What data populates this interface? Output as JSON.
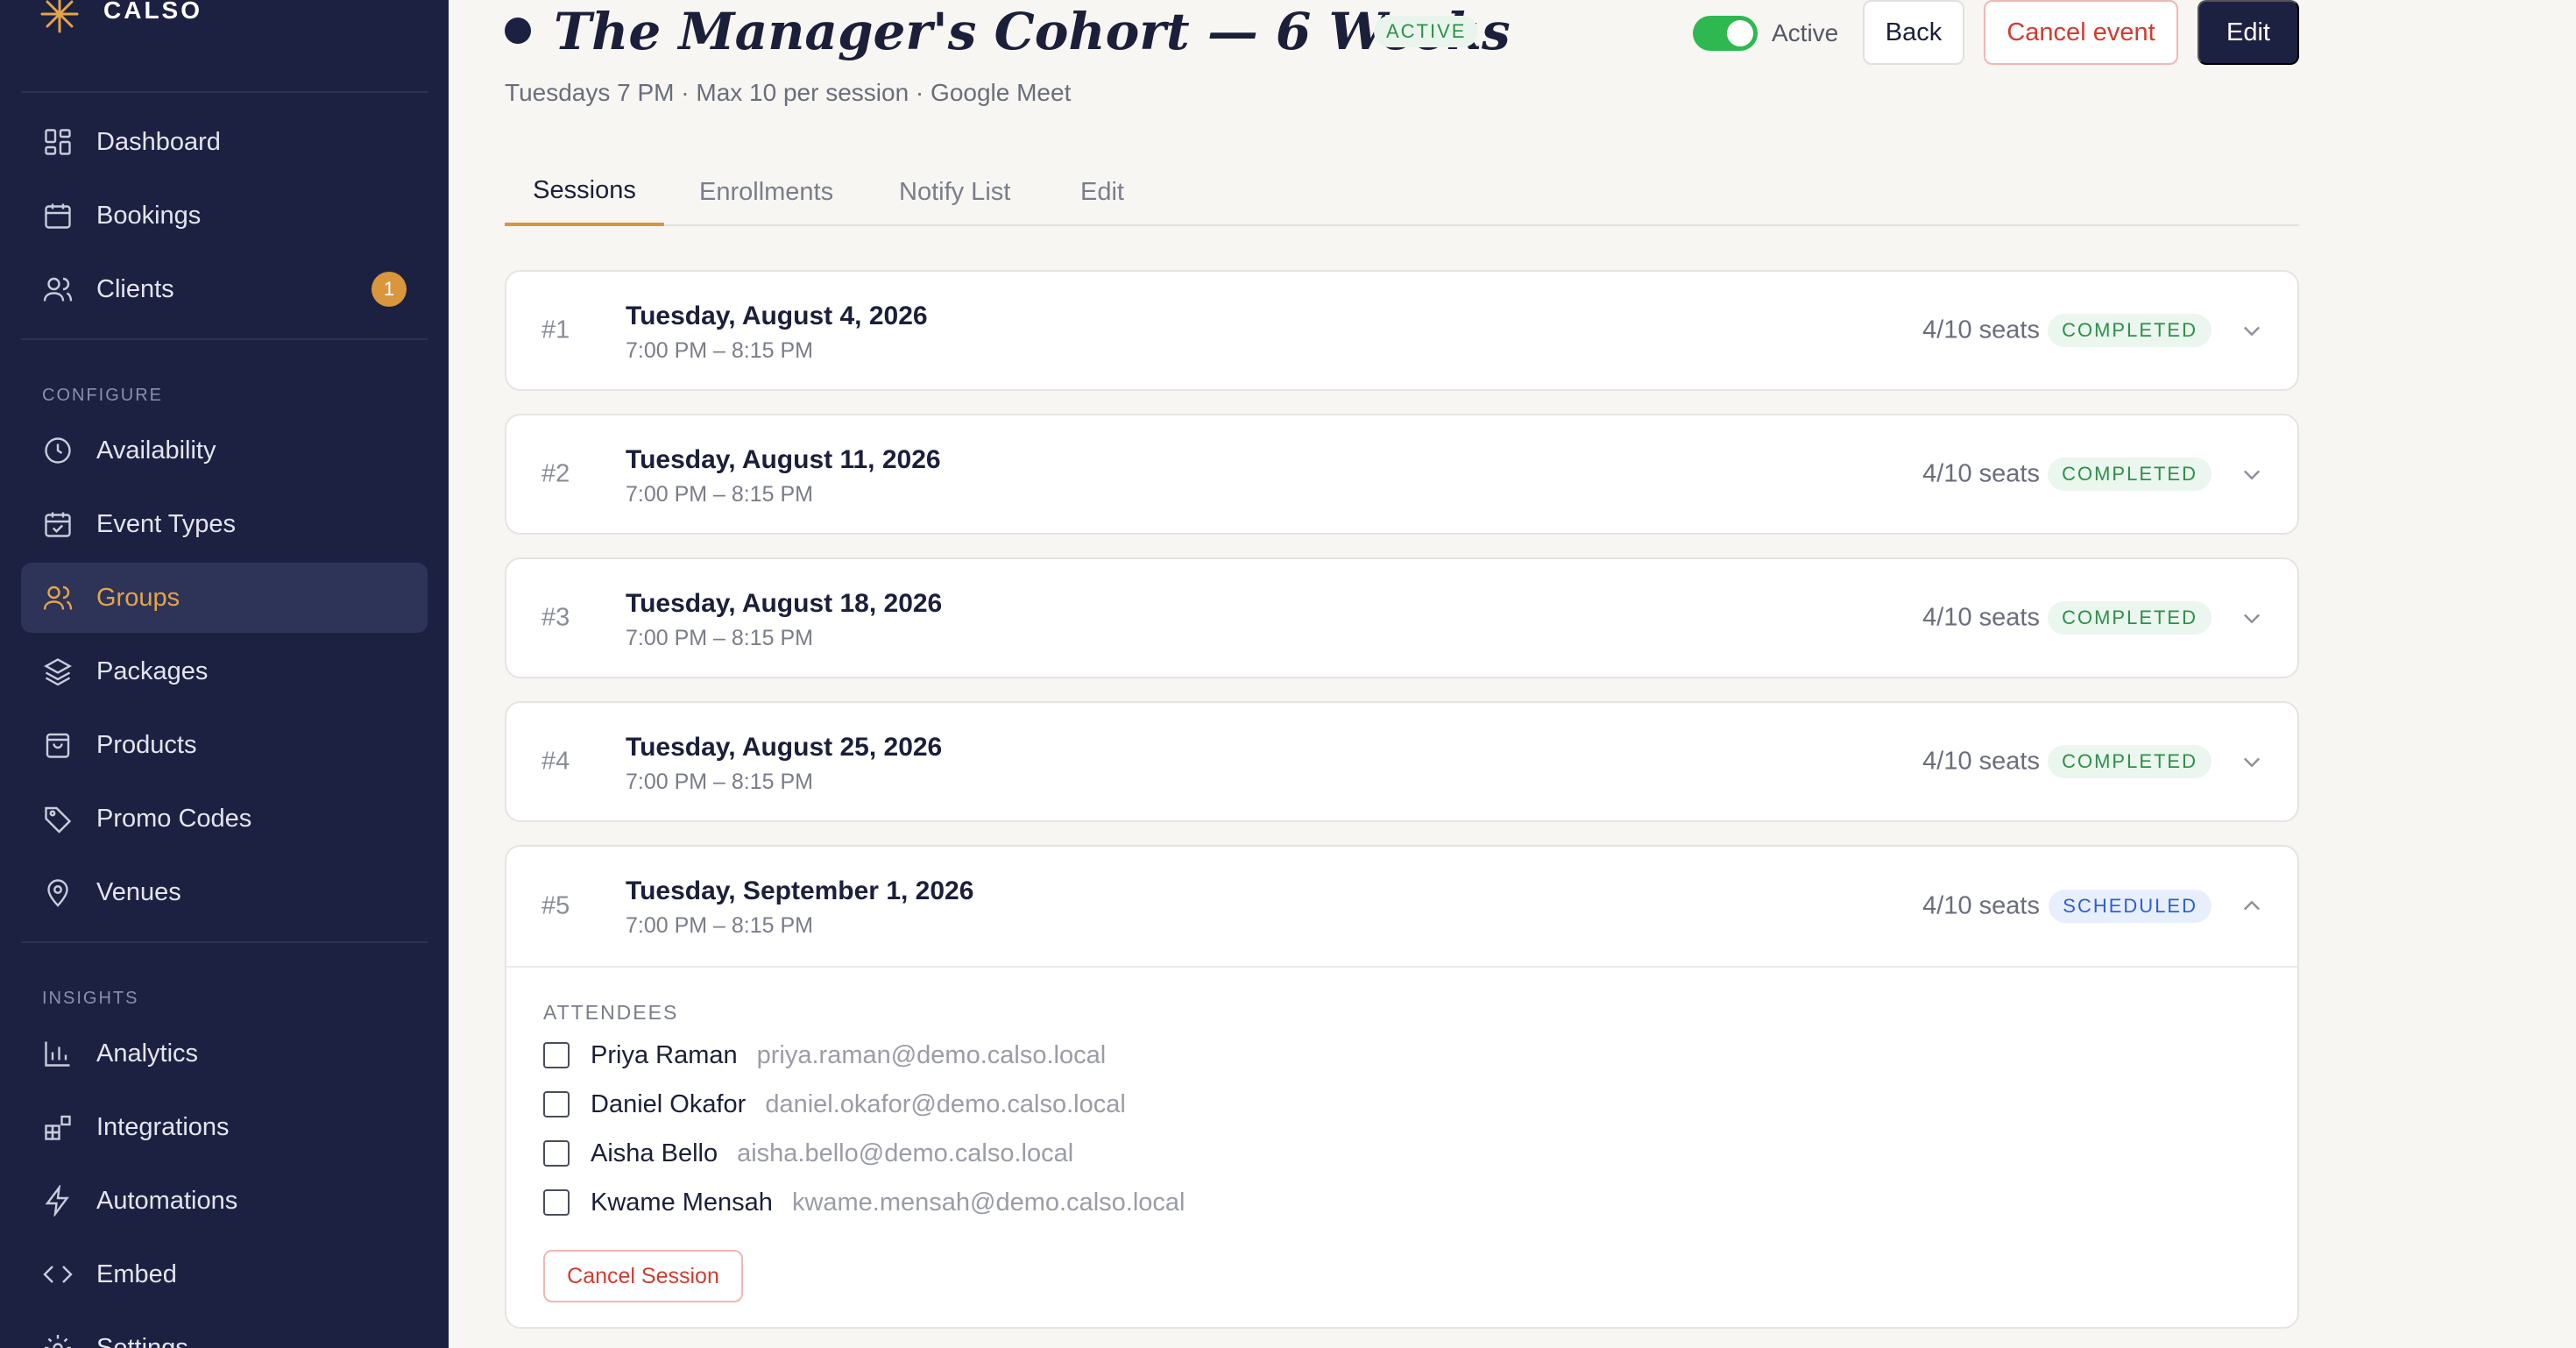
{
  "app": {
    "brand": "CALSO"
  },
  "sidebar": {
    "primary": [
      {
        "label": "Dashboard",
        "icon": "dashboard-icon"
      },
      {
        "label": "Bookings",
        "icon": "calendar-icon"
      },
      {
        "label": "Clients",
        "icon": "users-icon",
        "badge": "1"
      }
    ],
    "configure_label": "CONFIGURE",
    "configure": [
      {
        "label": "Availability",
        "icon": "clock-icon"
      },
      {
        "label": "Event Types",
        "icon": "calendar-check-icon"
      },
      {
        "label": "Groups",
        "icon": "users-icon",
        "active": true
      },
      {
        "label": "Packages",
        "icon": "layers-icon"
      },
      {
        "label": "Products",
        "icon": "shopping-bag-icon"
      },
      {
        "label": "Promo Codes",
        "icon": "tag-icon"
      },
      {
        "label": "Venues",
        "icon": "map-pin-icon"
      }
    ],
    "insights_label": "INSIGHTS",
    "insights": [
      {
        "label": "Analytics",
        "icon": "bar-chart-icon"
      },
      {
        "label": "Integrations",
        "icon": "integrations-icon"
      },
      {
        "label": "Automations",
        "icon": "lightning-icon"
      },
      {
        "label": "Embed",
        "icon": "code-icon"
      },
      {
        "label": "Settings",
        "icon": "gear-icon"
      }
    ]
  },
  "header": {
    "title": "The Manager's Cohort — 6 Weeks",
    "status": "ACTIVE",
    "subtitle": "Tuesdays 7 PM · Max 10 per session · Google Meet",
    "toggle_label": "Active",
    "back_label": "Back",
    "cancel_event_label": "Cancel event",
    "edit_label": "Edit"
  },
  "tabs": [
    {
      "label": "Sessions",
      "active": true
    },
    {
      "label": "Enrollments"
    },
    {
      "label": "Notify List"
    },
    {
      "label": "Edit"
    }
  ],
  "sessions": [
    {
      "num": "#1",
      "date": "Tuesday, August 4, 2026",
      "time": "7:00 PM – 8:15 PM",
      "seats": "4/10 seats",
      "status": "COMPLETED"
    },
    {
      "num": "#2",
      "date": "Tuesday, August 11, 2026",
      "time": "7:00 PM – 8:15 PM",
      "seats": "4/10 seats",
      "status": "COMPLETED"
    },
    {
      "num": "#3",
      "date": "Tuesday, August 18, 2026",
      "time": "7:00 PM – 8:15 PM",
      "seats": "4/10 seats",
      "status": "COMPLETED"
    },
    {
      "num": "#4",
      "date": "Tuesday, August 25, 2026",
      "time": "7:00 PM – 8:15 PM",
      "seats": "4/10 seats",
      "status": "COMPLETED"
    },
    {
      "num": "#5",
      "date": "Tuesday, September 1, 2026",
      "time": "7:00 PM – 8:15 PM",
      "seats": "4/10 seats",
      "status": "SCHEDULED"
    }
  ],
  "expanded_session": {
    "attendees_label": "ATTENDEES",
    "attendees": [
      {
        "name": "Priya Raman",
        "email": "priya.raman@demo.calso.local"
      },
      {
        "name": "Daniel Okafor",
        "email": "daniel.okafor@demo.calso.local"
      },
      {
        "name": "Aisha Bello",
        "email": "aisha.bello@demo.calso.local"
      },
      {
        "name": "Kwame Mensah",
        "email": "kwame.mensah@demo.calso.local"
      }
    ],
    "cancel_session_label": "Cancel Session"
  },
  "colors": {
    "sidebar_bg": "#1c2142",
    "accent": "#d9963c",
    "active_green": "#2fb84f",
    "danger": "#d23b30",
    "scheduled_blue": "#2e5fd0"
  }
}
